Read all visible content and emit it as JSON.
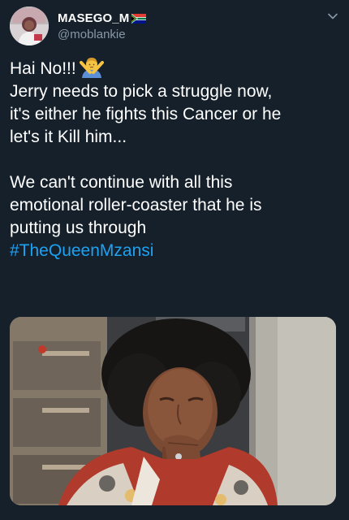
{
  "user": {
    "display_name": "MASEGO_M",
    "handle": "@moblankie",
    "flag_icon": "south-africa-flag-icon",
    "avatar_icon": "user-avatar"
  },
  "tweet": {
    "lines": [
      "Hai No!!!",
      "Jerry needs to pick a struggle now,",
      "it's either he fights this Cancer or he",
      "let's it Kill him...",
      "",
      "We can't continue with all this",
      "emotional roller-coaster that he is",
      "putting us through"
    ],
    "emoji_icon": "person-gesturing-no-icon",
    "hashtag": "#TheQueenMzansi"
  },
  "media": {
    "type": "photo",
    "label_icon": "tweet-image"
  },
  "colors": {
    "background": "#15202b",
    "text_primary": "#ffffff",
    "text_secondary": "#8899a6",
    "link": "#1da1f2"
  },
  "icons": {
    "menu": "chevron-down-icon"
  }
}
